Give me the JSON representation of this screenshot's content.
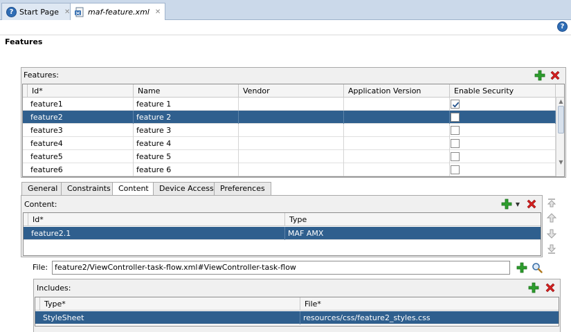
{
  "tabs": [
    {
      "label": "Start Page",
      "icon": "help-icon"
    },
    {
      "label": "maf-feature.xml",
      "icon": "xml-file-icon"
    }
  ],
  "page_title": "Features",
  "features_panel": {
    "label": "Features:",
    "columns": [
      "Id*",
      "Name",
      "Vendor",
      "Application Version",
      "Enable Security"
    ],
    "rows": [
      {
        "id": "feature1",
        "name": "feature 1",
        "vendor": "",
        "app_version": "",
        "enable_security": true
      },
      {
        "id": "feature2",
        "name": "feature 2",
        "vendor": "",
        "app_version": "",
        "enable_security": false
      },
      {
        "id": "feature3",
        "name": "feature 3",
        "vendor": "",
        "app_version": "",
        "enable_security": false
      },
      {
        "id": "feature4",
        "name": "feature 4",
        "vendor": "",
        "app_version": "",
        "enable_security": false
      },
      {
        "id": "feature5",
        "name": "feature 5",
        "vendor": "",
        "app_version": "",
        "enable_security": false
      },
      {
        "id": "feature6",
        "name": "feature 6",
        "vendor": "",
        "app_version": "",
        "enable_security": false
      }
    ],
    "selected_row": 1
  },
  "sub_tabs": [
    "General",
    "Constraints",
    "Content",
    "Device Access",
    "Preferences"
  ],
  "active_sub_tab": "Content",
  "content_panel": {
    "label": "Content:",
    "columns": [
      "Id*",
      "Type"
    ],
    "rows": [
      {
        "id": "feature2.1",
        "type": "MAF AMX"
      }
    ]
  },
  "file_field": {
    "label": "File:",
    "value": "feature2/ViewController-task-flow.xml#ViewController-task-flow"
  },
  "includes_panel": {
    "label": "Includes:",
    "columns": [
      "Type*",
      "File*"
    ],
    "rows": [
      {
        "type": "StyleSheet",
        "file": "resources/css/feature2_styles.css"
      }
    ]
  },
  "colors": {
    "selection": "#2f5f8e",
    "tab_bar": "#cbd9ea",
    "add_green": "#2e9e2e",
    "delete_red": "#d42020"
  }
}
